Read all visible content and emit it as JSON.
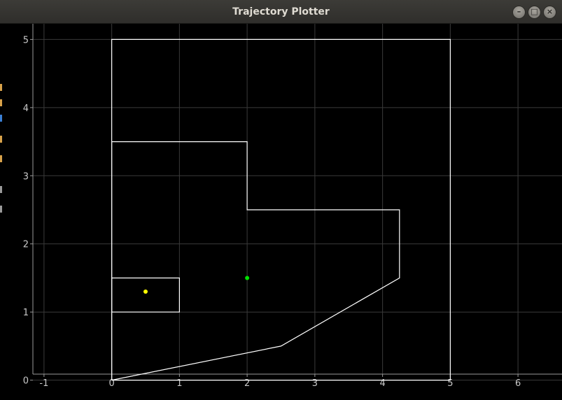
{
  "window": {
    "title": "Trajectory Plotter",
    "controls": {
      "minimize_icon": "minimize-icon",
      "maximize_icon": "maximize-icon",
      "close_icon": "close-icon",
      "minimize_glyph": "–",
      "maximize_glyph": "□",
      "close_glyph": "×"
    }
  },
  "colors": {
    "background": "#000000",
    "grid": "#3a3a3a",
    "axis": "#9a9a9a",
    "tick_label": "#c8c8c8",
    "outline": "#ffffff",
    "robot_point": "#ffff00",
    "goal_point": "#00e000"
  },
  "plot": {
    "x_range": [
      -1.65,
      6.65
    ],
    "y_range": [
      -0.25,
      5.23
    ],
    "x_ticks": [
      -1,
      0,
      1,
      2,
      3,
      4,
      5,
      6
    ],
    "y_ticks": [
      0,
      1,
      2,
      3,
      4,
      5
    ],
    "x_tick_labels": [
      "-1",
      "0",
      "1",
      "2",
      "3",
      "4",
      "5",
      "6"
    ],
    "y_tick_labels": [
      "0",
      "1",
      "2",
      "3",
      "4",
      "5"
    ],
    "grid": true,
    "polylines": [
      {
        "name": "outer-boundary",
        "points": [
          [
            0,
            0
          ],
          [
            5,
            0
          ],
          [
            5,
            5
          ],
          [
            0,
            5
          ],
          [
            0,
            0
          ]
        ]
      },
      {
        "name": "obstacle-region",
        "points": [
          [
            0,
            0
          ],
          [
            2.5,
            0.5
          ],
          [
            4.25,
            1.5
          ],
          [
            4.25,
            2.5
          ],
          [
            2,
            2.5
          ],
          [
            2,
            3.5
          ],
          [
            0,
            3.5
          ],
          [
            0,
            0
          ]
        ]
      },
      {
        "name": "start-box",
        "points": [
          [
            0,
            1
          ],
          [
            1,
            1
          ],
          [
            1,
            1.5
          ],
          [
            0,
            1.5
          ],
          [
            0,
            1
          ]
        ]
      }
    ],
    "points": [
      {
        "name": "robot-point",
        "x": 0.5,
        "y": 1.3,
        "color": "#ffff00"
      },
      {
        "name": "goal-point",
        "x": 2,
        "y": 1.5,
        "color": "#00e000"
      }
    ]
  },
  "left_strip_colors": [
    "#d8a24a",
    "#d8a24a",
    "#3b7fd4",
    "#d8a24a",
    "#d8a24a",
    "#9a9a9a",
    "#9a9a9a"
  ]
}
